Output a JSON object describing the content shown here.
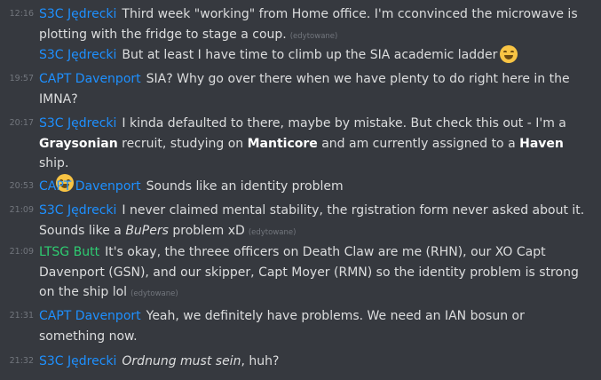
{
  "messages": [
    {
      "time": "12:16",
      "author": "S3C Jędrecki",
      "text": "Third week \"working\" from Home office. I'm cconvinced the microwave is plotting with the fridge to stage a coup.",
      "edited": "(edytowane)"
    },
    {
      "author": "S3C Jędrecki",
      "text": "But at least I have time to climb up the SIA academic ladder",
      "emoji": "grinning-emoji"
    },
    {
      "time": "19:57",
      "author": "CAPT Davenport",
      "text": "SIA?  Why go over there when we have plenty to do right here in the IMNA?"
    },
    {
      "time": "20:17",
      "author": "S3C Jędrecki",
      "parts": [
        "I kinda defaulted to there, maybe by mistake. But check this out - I'm a ",
        "Graysonian",
        " recruit, studying on ",
        "Manticore",
        " and am currently assigned to a ",
        "Haven",
        " ship."
      ],
      "emoji": "grinning-emoji"
    },
    {
      "time": "20:53",
      "author": "CAPT Davenport",
      "text": "Sounds like an identity problem"
    },
    {
      "time": "21:09",
      "author": "S3C Jędrecki",
      "parts": [
        "I never claimed mental stability, the rgistration form never asked about it. Sounds like a ",
        "BuPers",
        " problem xD"
      ],
      "edited": "(edytowane)"
    },
    {
      "time": "21:09",
      "author": "LTSG Butt",
      "text": "It's okay, the threee officers on Death Claw are me (RHN), our XO Capt Davenport (GSN), and our skipper, Capt Moyer (RMN) so the identity problem is strong on the ship lol",
      "edited": "(edytowane)"
    },
    {
      "time": "21:31",
      "author": "CAPT Davenport",
      "text": "Yeah, we definitely have problems.  We need an IAN bosun or something now."
    },
    {
      "time": "21:32",
      "author": "S3C Jędrecki",
      "parts": [
        "Ordnung must sein",
        ", huh?"
      ]
    }
  ],
  "colors": {
    "background": "#36393f",
    "author_blue": "#1e90ff",
    "author_green": "#2ecc71",
    "timestamp": "#72767d",
    "text": "#dcddde"
  }
}
